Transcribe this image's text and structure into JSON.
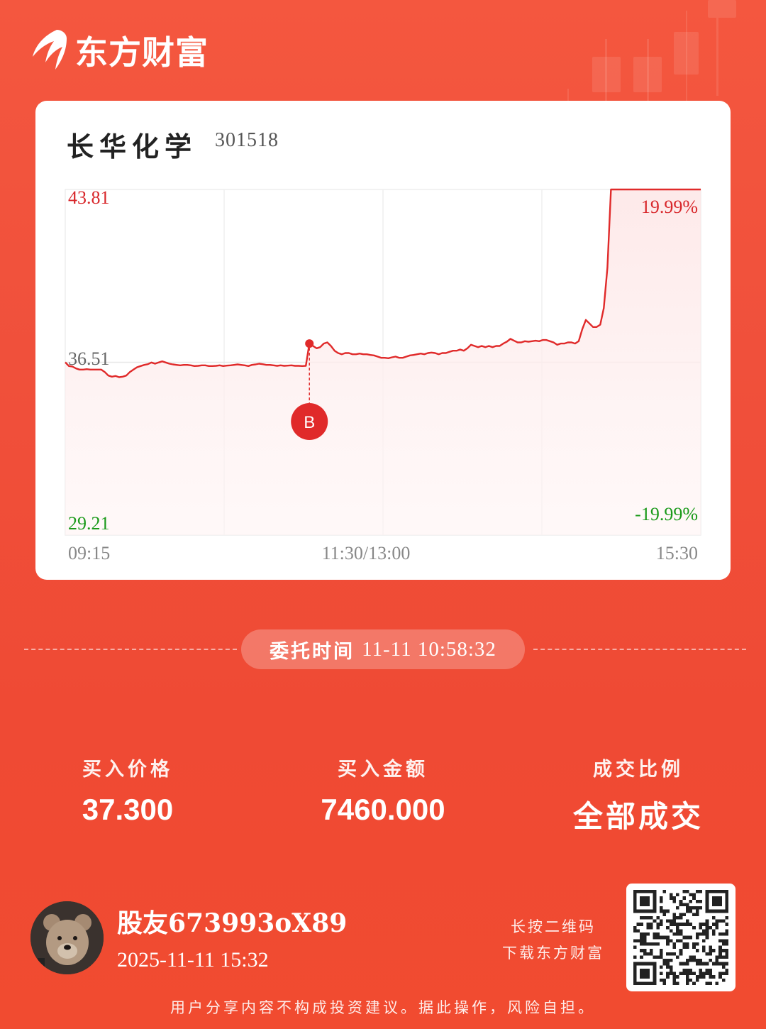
{
  "brand": {
    "name": "东方财富",
    "logo_icon": "eastmoney-logo-icon"
  },
  "stock": {
    "name": "长华化学",
    "code": "301518"
  },
  "chart_data": {
    "type": "line",
    "x_ticks": [
      "09:15",
      "11:30/13:00",
      "15:30"
    ],
    "price_labels": {
      "high": "43.81",
      "mid": "36.51",
      "low": "29.21"
    },
    "pct_labels": {
      "high": "19.99%",
      "low": "-19.99%"
    },
    "ylim": [
      29.21,
      43.81
    ],
    "base_price": 36.51,
    "buy_marker": {
      "label": "B",
      "x_index": 68,
      "price": 37.3
    },
    "prices": [
      36.51,
      36.35,
      36.33,
      36.25,
      36.2,
      36.2,
      36.22,
      36.2,
      36.2,
      36.2,
      36.2,
      36.1,
      35.95,
      35.9,
      35.93,
      35.88,
      35.9,
      35.95,
      36.1,
      36.2,
      36.3,
      36.35,
      36.4,
      36.43,
      36.5,
      36.45,
      36.5,
      36.55,
      36.5,
      36.45,
      36.42,
      36.4,
      36.38,
      36.4,
      36.4,
      36.38,
      36.35,
      36.36,
      36.38,
      36.38,
      36.35,
      36.35,
      36.36,
      36.38,
      36.35,
      36.37,
      36.38,
      36.4,
      36.42,
      36.4,
      36.38,
      36.35,
      36.4,
      36.42,
      36.45,
      36.43,
      36.4,
      36.4,
      36.38,
      36.36,
      36.38,
      36.36,
      36.37,
      36.38,
      36.36,
      36.36,
      36.35,
      36.36,
      37.3,
      37.2,
      37.1,
      37.15,
      37.3,
      37.35,
      37.2,
      37.0,
      36.9,
      36.85,
      36.9,
      36.9,
      36.85,
      36.85,
      36.88,
      36.85,
      36.85,
      36.82,
      36.8,
      36.75,
      36.7,
      36.7,
      36.68,
      36.72,
      36.75,
      36.7,
      36.7,
      36.75,
      36.8,
      36.82,
      36.85,
      36.88,
      36.85,
      36.9,
      36.92,
      36.9,
      36.85,
      36.9,
      36.9,
      36.95,
      37.0,
      37.0,
      37.05,
      37.0,
      37.1,
      37.25,
      37.2,
      37.15,
      37.2,
      37.15,
      37.2,
      37.15,
      37.2,
      37.2,
      37.3,
      37.38,
      37.5,
      37.42,
      37.35,
      37.35,
      37.4,
      37.38,
      37.4,
      37.42,
      37.4,
      37.45,
      37.45,
      37.4,
      37.35,
      37.25,
      37.3,
      37.3,
      37.35,
      37.35,
      37.3,
      37.4,
      37.9,
      38.3,
      38.15,
      38.0,
      38.0,
      38.1,
      38.8,
      40.5,
      43.81,
      43.81,
      43.81,
      43.81,
      43.81,
      43.81,
      43.81,
      43.81,
      43.81,
      43.81,
      43.81,
      43.81,
      43.81,
      43.81,
      43.81,
      43.81,
      43.81,
      43.81,
      43.81,
      43.81,
      43.81,
      43.81,
      43.81,
      43.81,
      43.81,
      43.81
    ]
  },
  "order": {
    "time_label": "委托时间",
    "time_value": "11-11 10:58:32"
  },
  "stats": {
    "price_label": "买入价格",
    "price_value": "37.300",
    "amount_label": "买入金额",
    "amount_value": "7460.000",
    "ratio_label": "成交比例",
    "ratio_value": "全部成交"
  },
  "user": {
    "name": "股友673993oX89",
    "time": "2025-11-11 15:32",
    "avatar_icon": "teddy-bear-avatar"
  },
  "qr": {
    "hint_line1": "长按二维码",
    "hint_line2": "下载东方财富"
  },
  "disclaimer": "用户分享内容不构成投资建议。据此操作，风险自担。",
  "colors": {
    "up": "#e02a2a",
    "down": "#1a9a1a",
    "neutral": "#666666",
    "background": "#f0503b"
  }
}
